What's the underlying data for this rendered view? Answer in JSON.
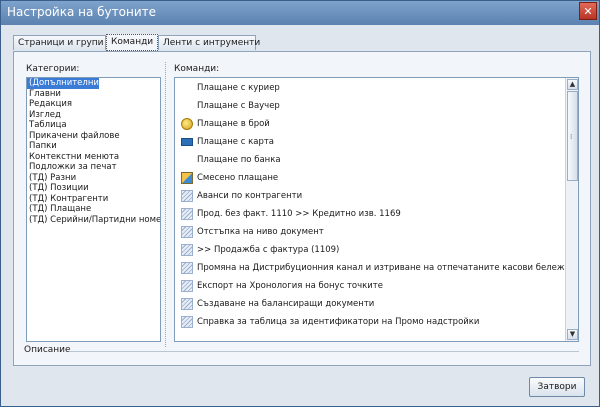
{
  "window": {
    "title": "Настройка на бутоните",
    "close_glyph": "✕"
  },
  "tabs": [
    {
      "label": "Страници и групи",
      "active": false
    },
    {
      "label": "Команди",
      "active": true
    },
    {
      "label": "Ленти с интрументи",
      "active": false
    }
  ],
  "categories": {
    "label": "Категории:",
    "items": [
      "(Допълнителни)",
      "Главни",
      "Редакция",
      "Изглед",
      "Таблица",
      "Прикачени файлове",
      "Папки",
      "Контекстни менюта",
      "Подложки за печат",
      "(ТД) Разни",
      "(ТД) Позиции",
      "(ТД) Контрагенти",
      "(ТД) Плащане",
      "(ТД) Серийни/Партидни номе"
    ],
    "selected": 0
  },
  "commands": {
    "label": "Команди:",
    "items": [
      {
        "label": "Плащане с куриер",
        "icon": "none"
      },
      {
        "label": "Плащане с Ваучер",
        "icon": "none"
      },
      {
        "label": "Плащане в брой",
        "icon": "coins-icon"
      },
      {
        "label": "Плащане с карта",
        "icon": "card-icon"
      },
      {
        "label": "Плащане по банка",
        "icon": "none"
      },
      {
        "label": "Смесено плащане",
        "icon": "mixed-payment-icon"
      },
      {
        "label": "Аванси по контрагенти",
        "icon": "document-icon"
      },
      {
        "label": "Прод. без факт. 1110 >> Кредитно изв. 1169",
        "icon": "document-icon"
      },
      {
        "label": "Отстъпка на ниво документ",
        "icon": "document-icon"
      },
      {
        "label": ">> Продажба с фактура (1109)",
        "icon": "document-icon"
      },
      {
        "label": "Промяна на Дистрибуционния канал и изтриване на отпечатаните касови бележки",
        "icon": "document-icon"
      },
      {
        "label": "Експорт на Хронология на бонус точките",
        "icon": "document-icon"
      },
      {
        "label": "Създаване на балансиращи документи",
        "icon": "document-icon"
      },
      {
        "label": "Справка за таблица за идентификатори на Промо надстройки",
        "icon": "document-icon"
      }
    ],
    "scroll_up": "▲",
    "scroll_down": "▼"
  },
  "description": {
    "label": "Описание"
  },
  "buttons": {
    "close": "Затвори"
  }
}
